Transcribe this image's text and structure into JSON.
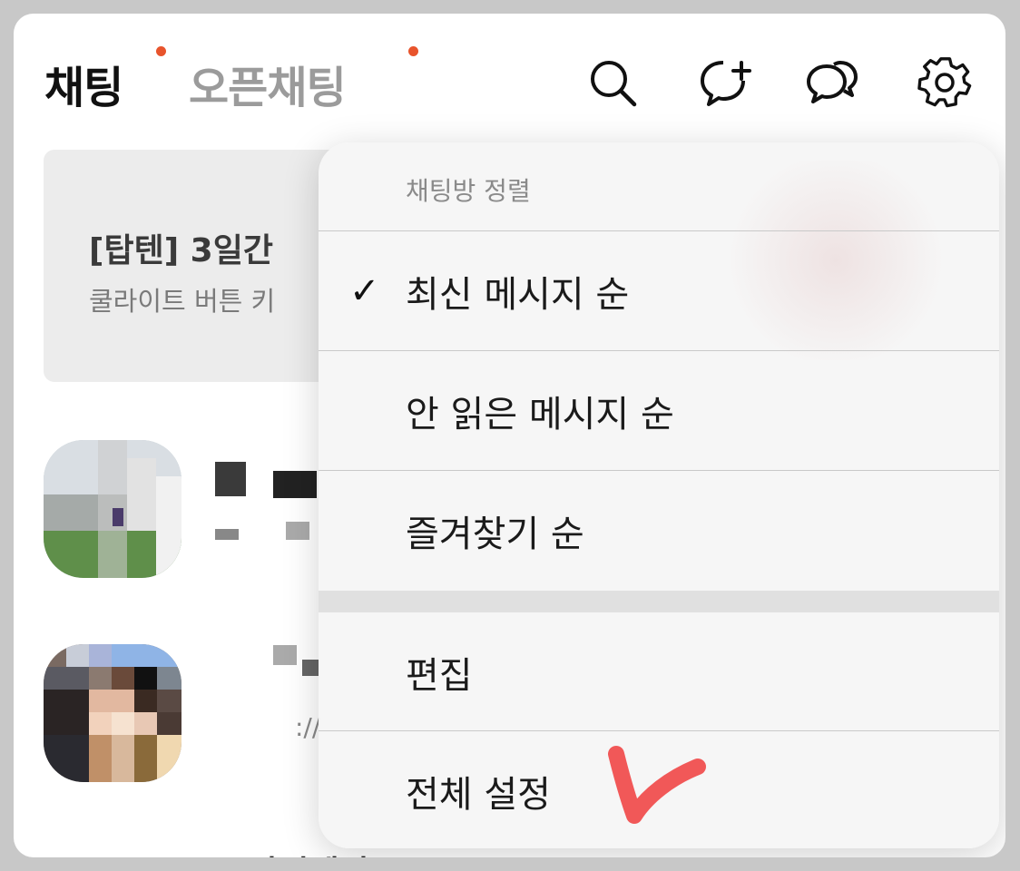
{
  "header": {
    "tab_chat": "채팅",
    "tab_openchat": "오픈채팅",
    "icons": [
      "search-icon",
      "new-chat-icon",
      "open-chat-icon",
      "settings-icon"
    ],
    "accent_color": "#e8542c"
  },
  "banner": {
    "title": "[탑텐] 3일간",
    "subtitle": "쿨라이트 버튼 키"
  },
  "chat_list": {
    "items": [
      {
        "name": "",
        "preview": ""
      },
      {
        "name": "",
        "preview": "://"
      }
    ],
    "bottom_peek": "스마일페이"
  },
  "menu": {
    "header": "채팅방 정렬",
    "sort_options": [
      {
        "label": "최신 메시지 순",
        "checked": true
      },
      {
        "label": "안 읽은 메시지 순",
        "checked": false
      },
      {
        "label": "즐겨찾기 순",
        "checked": false
      }
    ],
    "check_mark": "✓",
    "actions": [
      {
        "label": "편집"
      },
      {
        "label": "전체 설정"
      }
    ],
    "annotation_color": "#f03c3c"
  }
}
